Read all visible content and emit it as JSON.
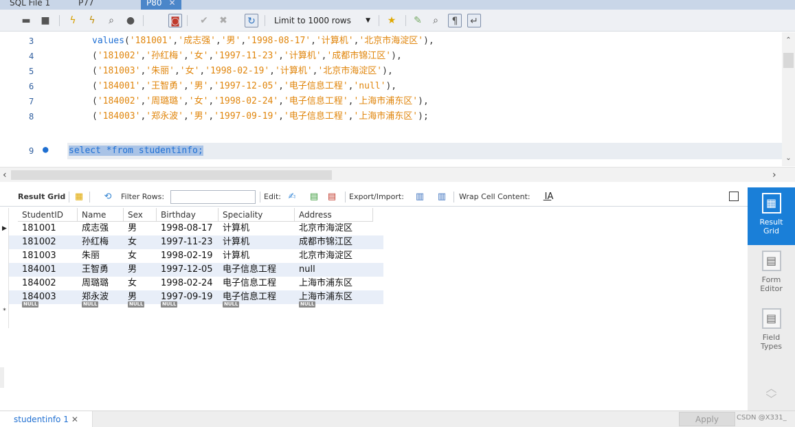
{
  "tabs": [
    {
      "label": "SQL File 1",
      "active": false
    },
    {
      "label": "P77",
      "active": false
    },
    {
      "label": "P80",
      "active": true
    }
  ],
  "toolbar": {
    "limit_label": "Limit to 1000 rows",
    "icons": [
      "folder-open-icon",
      "save-icon",
      "lightning-icon",
      "lightning-cursor-icon",
      "magnify-icon",
      "stop-icon",
      "toggle-icon",
      "commit-icon",
      "rollback-icon",
      "autocommit-icon",
      "dropdown-icon",
      "star-icon",
      "brush-icon",
      "search-icon",
      "paragraph-icon",
      "wrap-icon"
    ]
  },
  "editor": {
    "lines": [
      {
        "number": "3",
        "tokens": [
          {
            "t": "values",
            "c": "kw"
          },
          {
            "t": "(",
            "c": "punc"
          },
          {
            "t": "'181001'",
            "c": "str"
          },
          {
            "t": ",",
            "c": "punc"
          },
          {
            "t": "'成志强'",
            "c": "str"
          },
          {
            "t": ",",
            "c": "punc"
          },
          {
            "t": "'男'",
            "c": "str"
          },
          {
            "t": ",",
            "c": "punc"
          },
          {
            "t": "'1998-08-17'",
            "c": "str"
          },
          {
            "t": ",",
            "c": "punc"
          },
          {
            "t": "'计算机'",
            "c": "str"
          },
          {
            "t": ",",
            "c": "punc"
          },
          {
            "t": "'北京市海淀区'",
            "c": "str"
          },
          {
            "t": "),",
            "c": "punc"
          }
        ]
      },
      {
        "number": "4",
        "tokens": [
          {
            "t": "(",
            "c": "punc"
          },
          {
            "t": "'181002'",
            "c": "str"
          },
          {
            "t": ",",
            "c": "punc"
          },
          {
            "t": "'孙红梅'",
            "c": "str"
          },
          {
            "t": ",",
            "c": "punc"
          },
          {
            "t": "'女'",
            "c": "str"
          },
          {
            "t": ",",
            "c": "punc"
          },
          {
            "t": "'1997-11-23'",
            "c": "str"
          },
          {
            "t": ",",
            "c": "punc"
          },
          {
            "t": "'计算机'",
            "c": "str"
          },
          {
            "t": ",",
            "c": "punc"
          },
          {
            "t": "'成都市锦江区'",
            "c": "str"
          },
          {
            "t": "),",
            "c": "punc"
          }
        ]
      },
      {
        "number": "5",
        "tokens": [
          {
            "t": "(",
            "c": "punc"
          },
          {
            "t": "'181003'",
            "c": "str"
          },
          {
            "t": ",",
            "c": "punc"
          },
          {
            "t": "'朱丽'",
            "c": "str"
          },
          {
            "t": ",",
            "c": "punc"
          },
          {
            "t": "'女'",
            "c": "str"
          },
          {
            "t": ",",
            "c": "punc"
          },
          {
            "t": "'1998-02-19'",
            "c": "str"
          },
          {
            "t": ",",
            "c": "punc"
          },
          {
            "t": "'计算机'",
            "c": "str"
          },
          {
            "t": ",",
            "c": "punc"
          },
          {
            "t": "'北京市海淀区'",
            "c": "str"
          },
          {
            "t": "),",
            "c": "punc"
          }
        ]
      },
      {
        "number": "6",
        "tokens": [
          {
            "t": "(",
            "c": "punc"
          },
          {
            "t": "'184001'",
            "c": "str"
          },
          {
            "t": ",",
            "c": "punc"
          },
          {
            "t": "'王智勇'",
            "c": "str"
          },
          {
            "t": ",",
            "c": "punc"
          },
          {
            "t": "'男'",
            "c": "str"
          },
          {
            "t": ",",
            "c": "punc"
          },
          {
            "t": "'1997-12-05'",
            "c": "str"
          },
          {
            "t": ",",
            "c": "punc"
          },
          {
            "t": "'电子信息工程'",
            "c": "str"
          },
          {
            "t": ",",
            "c": "punc"
          },
          {
            "t": "'null'",
            "c": "str"
          },
          {
            "t": "),",
            "c": "punc"
          }
        ]
      },
      {
        "number": "7",
        "tokens": [
          {
            "t": "(",
            "c": "punc"
          },
          {
            "t": "'184002'",
            "c": "str"
          },
          {
            "t": ",",
            "c": "punc"
          },
          {
            "t": "'周璐璐'",
            "c": "str"
          },
          {
            "t": ",",
            "c": "punc"
          },
          {
            "t": "'女'",
            "c": "str"
          },
          {
            "t": ",",
            "c": "punc"
          },
          {
            "t": "'1998-02-24'",
            "c": "str"
          },
          {
            "t": ",",
            "c": "punc"
          },
          {
            "t": "'电子信息工程'",
            "c": "str"
          },
          {
            "t": ",",
            "c": "punc"
          },
          {
            "t": "'上海市浦东区'",
            "c": "str"
          },
          {
            "t": "),",
            "c": "punc"
          }
        ]
      },
      {
        "number": "8",
        "tokens": [
          {
            "t": "(",
            "c": "punc"
          },
          {
            "t": "'184003'",
            "c": "str"
          },
          {
            "t": ",",
            "c": "punc"
          },
          {
            "t": "'郑永波'",
            "c": "str"
          },
          {
            "t": ",",
            "c": "punc"
          },
          {
            "t": "'男'",
            "c": "str"
          },
          {
            "t": ",",
            "c": "punc"
          },
          {
            "t": "'1997-09-19'",
            "c": "str"
          },
          {
            "t": ",",
            "c": "punc"
          },
          {
            "t": "'电子信息工程'",
            "c": "str"
          },
          {
            "t": ",",
            "c": "punc"
          },
          {
            "t": "'上海市浦东区'",
            "c": "str"
          },
          {
            "t": ");",
            "c": "punc"
          }
        ]
      },
      {
        "number": "9",
        "marker": "●",
        "tokens": [
          {
            "t": "select *from studentinfo;",
            "c": "kw selected"
          }
        ]
      }
    ]
  },
  "result_toolbar": {
    "result_grid_label": "Result Grid",
    "filter_label": "Filter Rows:",
    "edit_label": "Edit:",
    "export_label": "Export/Import:",
    "wrap_label": "Wrap Cell Content:"
  },
  "grid": {
    "columns": [
      "StudentID",
      "Name",
      "Sex",
      "Birthday",
      "Speciality",
      "Address"
    ],
    "rows": [
      [
        "181001",
        "成志强",
        "男",
        "1998-08-17",
        "计算机",
        "北京市海淀区"
      ],
      [
        "181002",
        "孙红梅",
        "女",
        "1997-11-23",
        "计算机",
        "成都市锦江区"
      ],
      [
        "181003",
        "朱丽",
        "女",
        "1998-02-19",
        "计算机",
        "北京市海淀区"
      ],
      [
        "184001",
        "王智勇",
        "男",
        "1997-12-05",
        "电子信息工程",
        "null"
      ],
      [
        "184002",
        "周璐璐",
        "女",
        "1998-02-24",
        "电子信息工程",
        "上海市浦东区"
      ],
      [
        "184003",
        "郑永波",
        "男",
        "1997-09-19",
        "电子信息工程",
        "上海市浦东区"
      ]
    ],
    "null_label": "NULL",
    "current_row_marker": "▶",
    "new_row_marker": "*"
  },
  "side_panel": {
    "buttons": [
      {
        "label1": "Result",
        "label2": "Grid",
        "active": true
      },
      {
        "label1": "Form",
        "label2": "Editor",
        "active": false
      },
      {
        "label1": "Field",
        "label2": "Types",
        "active": false
      }
    ]
  },
  "bottom": {
    "result_tab": "studentinfo 1",
    "apply": "Apply",
    "watermark": "CSDN @X331_"
  },
  "colors": {
    "keyword": "#1e6fd4",
    "string": "#e0850b",
    "accent": "#1a7fd8",
    "selection": "#a9c3e6",
    "alt_row": "#e8eef8"
  }
}
